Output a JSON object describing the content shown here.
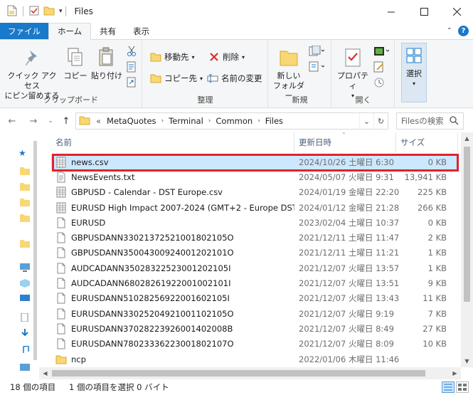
{
  "window": {
    "title": "Files"
  },
  "ribbon_tabs": [
    "ファイル",
    "ホーム",
    "共有",
    "表示"
  ],
  "clipboard": {
    "group_label": "クリップボード",
    "pin_label_1": "クイック アクセス",
    "pin_label_2": "にピン留めする",
    "copy_label": "コピー",
    "paste_label": "貼り付け"
  },
  "organize": {
    "group_label": "整理",
    "move_label": "移動先",
    "copy_to_label": "コピー先",
    "delete_label": "削除",
    "rename_label": "名前の変更"
  },
  "new_group": {
    "group_label": "新規",
    "new_folder_1": "新しい",
    "new_folder_2": "フォルダー"
  },
  "open_group": {
    "group_label": "開く",
    "properties_label": "プロパティ"
  },
  "select_group": {
    "select_label": "選択"
  },
  "address": {
    "overflow": "«",
    "crumbs": [
      "MetaQuotes",
      "Terminal",
      "Common",
      "Files"
    ],
    "search_placeholder": "Filesの検索"
  },
  "columns": {
    "name": "名前",
    "date": "更新日時",
    "size": "サイズ"
  },
  "files": [
    {
      "name": "news.csv",
      "date": "2024/10/26 土曜日 6:30",
      "size": "0 KB",
      "type": "csv",
      "selected": true
    },
    {
      "name": "NewsEvents.txt",
      "date": "2024/05/07 火曜日 9:31",
      "size": "13,941 KB",
      "type": "txt"
    },
    {
      "name": "GBPUSD - Calendar - DST Europe.csv",
      "date": "2024/01/19 金曜日 22:20",
      "size": "225 KB",
      "type": "csv"
    },
    {
      "name": "EURUSD High Impact 2007-2024 (GMT+2 - Europe DST).csv",
      "date": "2024/01/12 金曜日 21:28",
      "size": "266 KB",
      "type": "csv"
    },
    {
      "name": "EURUSD",
      "date": "2023/02/04 土曜日 10:37",
      "size": "0 KB",
      "type": "file"
    },
    {
      "name": "GBPUSDANN33021372521001802105O",
      "date": "2021/12/11 土曜日 11:47",
      "size": "2 KB",
      "type": "file"
    },
    {
      "name": "GBPUSDANN35004300924001202101O",
      "date": "2021/12/11 土曜日 11:21",
      "size": "1 KB",
      "type": "file"
    },
    {
      "name": "AUDCADANN35028322523001202105I",
      "date": "2021/12/07 火曜日 13:57",
      "size": "1 KB",
      "type": "file"
    },
    {
      "name": "AUDCADANN68028261922001002101I",
      "date": "2021/12/07 火曜日 13:51",
      "size": "9 KB",
      "type": "file"
    },
    {
      "name": "EURUSDANN51028256922001602105I",
      "date": "2021/12/07 火曜日 13:43",
      "size": "11 KB",
      "type": "file"
    },
    {
      "name": "EURUSDANN33025204921001102105O",
      "date": "2021/12/07 火曜日 9:19",
      "size": "7 KB",
      "type": "file"
    },
    {
      "name": "EURUSDANN37028223926001402008B",
      "date": "2021/12/07 火曜日 8:49",
      "size": "27 KB",
      "type": "file"
    },
    {
      "name": "EURUSDANN78023336223001802107O",
      "date": "2021/12/07 火曜日 8:09",
      "size": "10 KB",
      "type": "file"
    },
    {
      "name": "ncp",
      "date": "2022/01/06 木曜日 11:46",
      "size": "",
      "type": "folder"
    }
  ],
  "status": {
    "item_count": "18 個の項目",
    "selection": "1 個の項目を選択 0 バイト"
  },
  "colors": {
    "accent": "#1979ca",
    "selection_bg": "#cce8ff",
    "highlight_border": "#e0232e",
    "folder": "#f8d775"
  }
}
